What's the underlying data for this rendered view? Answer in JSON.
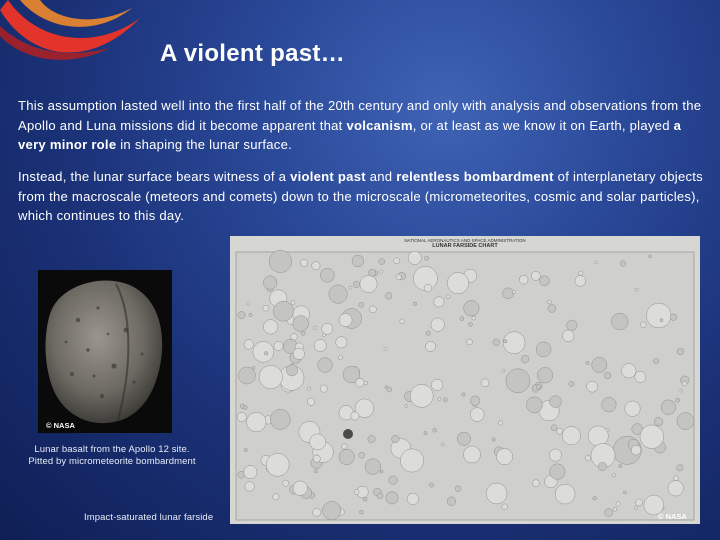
{
  "slide": {
    "title": "A violent past…",
    "p1": {
      "pre": "This assumption lasted well into the first half of the 20th century and only with analysis and observations from the Apollo and Luna missions did it become apparent that ",
      "b1": "volcanism",
      "mid": ", or at least as we know it on Earth, played ",
      "b2": "a very minor role",
      "post": " in shaping the lunar surface."
    },
    "p2": {
      "pre": "Instead, the lunar surface bears witness of a ",
      "b1": "violent past",
      "mid": " and ",
      "b2": "relentless bombardment",
      "post": " of interplanetary objects from the macroscale (meteors and comets) down to the microscale (micrometeorites, cosmic and solar particles), which continues to this day."
    }
  },
  "rock_image": {
    "credit": "© NASA",
    "caption_line1": "Lunar basalt from the Apollo 12 site.",
    "caption_line2": "Pitted by micrometeorite bombardment"
  },
  "farside_chart": {
    "header_line1": "NATIONAL AERONAUTICS AND SPACE ADMINISTRATION",
    "header_line2": "LUNAR FARSIDE CHART",
    "credit": "© NASA",
    "caption": "Impact-saturated lunar farside"
  },
  "colors": {
    "background": "#1b3278",
    "swoosh_red": "#e2342a",
    "swoosh_orange": "#f08a2c"
  }
}
